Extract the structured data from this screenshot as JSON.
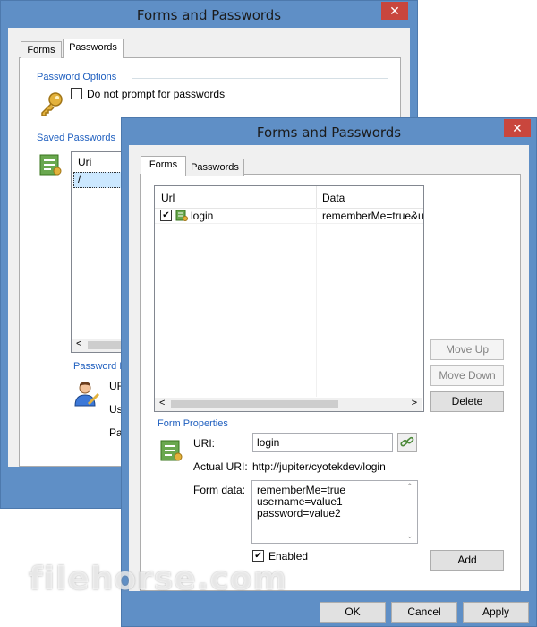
{
  "back": {
    "title": "Forms and Passwords",
    "close": "✕",
    "tabs": [
      "Forms",
      "Passwords"
    ],
    "password_options_label": "Password Options",
    "do_not_prompt": "Do not prompt for passwords",
    "saved_passwords_label": "Saved Passwords",
    "col_url": "Uri",
    "row1": "/",
    "password_props_label": "Password P",
    "partial1": "UR",
    "partial2": "Us",
    "partial3": "Pa"
  },
  "front": {
    "title": "Forms and Passwords",
    "close": "✕",
    "tabs": [
      "Forms",
      "Passwords"
    ],
    "list": {
      "col_url": "Url",
      "col_data": "Data",
      "rows": [
        {
          "url": "login",
          "data": "rememberMe=true&u",
          "checked": true
        }
      ]
    },
    "move_up": "Move Up",
    "move_down": "Move Down",
    "delete": "Delete",
    "form_props_label": "Form Properties",
    "uri_label": "URI:",
    "uri_value": "login",
    "actual_uri_label": "Actual URI:",
    "actual_uri_value": "http://jupiter/cyotekdev/login",
    "form_data_label": "Form data:",
    "form_data_lines": [
      "rememberMe=true",
      "username=value1",
      "password=value2"
    ],
    "enabled_label": "Enabled",
    "add": "Add",
    "ok": "OK",
    "cancel": "Cancel",
    "apply": "Apply"
  },
  "watermark": "filehorse.com"
}
